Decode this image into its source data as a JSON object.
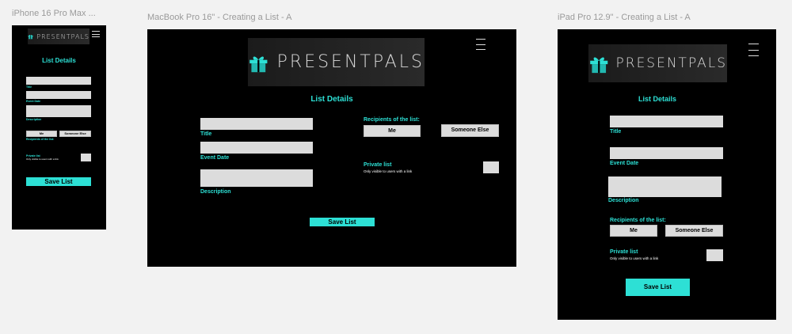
{
  "frames": {
    "iphone": {
      "label": "iPhone 16 Pro Max ...",
      "logo_text": "PRESENTPALS",
      "heading": "List Details",
      "title_label": "Title",
      "event_date_label": "Event Date",
      "description_label": "Description",
      "me_button": "Me",
      "someone_else_button": "Someone Else",
      "recipients_label": "Recipients of the list:",
      "private_label": "Private list",
      "private_sub": "Only visible to users with a link",
      "save_button": "Save List"
    },
    "macbook": {
      "label": "MacBook Pro 16\" - Creating a List - A",
      "logo_text": "PRESENTPALS",
      "heading": "List Details",
      "title_label": "Title",
      "event_date_label": "Event Date",
      "description_label": "Description",
      "recipients_label": "Recipients of the list:",
      "me_button": "Me",
      "someone_else_button": "Someone Else",
      "private_label": "Private list",
      "private_sub": "Only visible to users with a link",
      "save_button": "Save List"
    },
    "ipad": {
      "label": "iPad Pro 12.9\" - Creating a List - A",
      "logo_text": "PRESENTPALS",
      "heading": "List Details",
      "title_label": "Title",
      "event_date_label": "Event Date",
      "description_label": "Description",
      "recipients_label": "Recipients of the list:",
      "me_button": "Me",
      "someone_else_button": "Someone Else",
      "private_label": "Private list",
      "private_sub": "Only visible to users with a link",
      "save_button": "Save List"
    }
  },
  "colors": {
    "canvas": "#f2f2f2",
    "frame_bg": "#000000",
    "accent": "#2de0d5",
    "field": "#dcdcdc"
  }
}
